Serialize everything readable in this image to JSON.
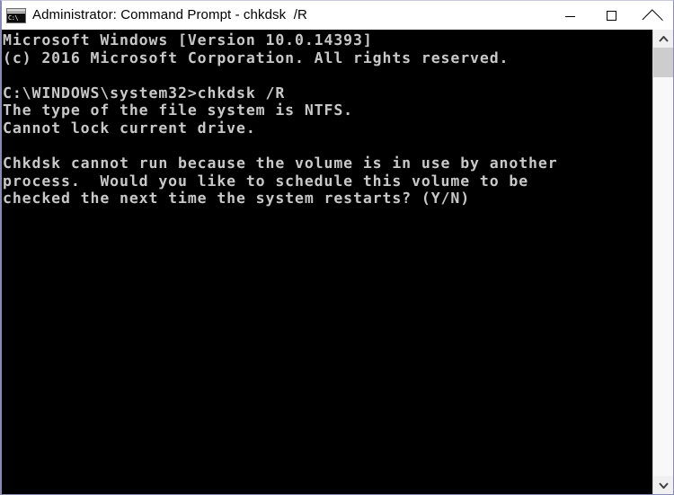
{
  "window": {
    "title": "Administrator: Command Prompt - chkdsk  /R",
    "icon_name": "command-prompt-icon",
    "icon_text": "C:\\",
    "controls": {
      "minimize_label": "Minimize",
      "maximize_label": "Maximize",
      "close_label": "Close"
    }
  },
  "console": {
    "background_color": "#000000",
    "text_color": "#c8c8c8",
    "lines": [
      "Microsoft Windows [Version 10.0.14393]",
      "(c) 2016 Microsoft Corporation. All rights reserved.",
      "",
      "C:\\WINDOWS\\system32>chkdsk /R",
      "The type of the file system is NTFS.",
      "Cannot lock current drive.",
      "",
      "Chkdsk cannot run because the volume is in use by another",
      "process.  Would you like to schedule this volume to be",
      "checked the next time the system restarts? (Y/N)"
    ],
    "text": "Microsoft Windows [Version 10.0.14393]\n(c) 2016 Microsoft Corporation. All rights reserved.\n\nC:\\WINDOWS\\system32>chkdsk /R\nThe type of the file system is NTFS.\nCannot lock current drive.\n\nChkdsk cannot run because the volume is in use by another\nprocess.  Would you like to schedule this volume to be\nchecked the next time the system restarts? (Y/N)"
  },
  "scrollbar": {
    "up_arrow_name": "scroll-up-arrow",
    "down_arrow_name": "scroll-down-arrow",
    "thumb_name": "scrollbar-thumb"
  }
}
